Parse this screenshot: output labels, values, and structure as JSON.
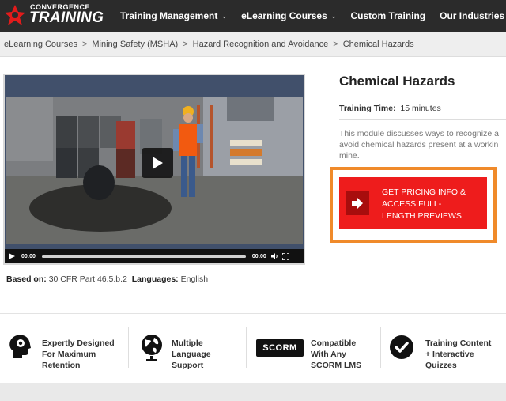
{
  "logo": {
    "small": "CONVERGENCE",
    "big": "TRAINING"
  },
  "nav": [
    {
      "label": "Training Management",
      "chevron": true
    },
    {
      "label": "eLearning Courses",
      "chevron": true
    },
    {
      "label": "Custom Training",
      "chevron": false
    },
    {
      "label": "Our Industries",
      "chevron": true
    }
  ],
  "breadcrumb": [
    "eLearning Courses",
    "Mining Safety (MSHA)",
    "Hazard Recognition and Avoidance",
    "Chemical Hazards"
  ],
  "breadcrumb_sep": ">",
  "video": {
    "current_time": "00:00",
    "duration": "00:00",
    "progress": 0
  },
  "meta": {
    "based_on_label": "Based on:",
    "based_on_value": "30 CFR Part 46.5.b.2",
    "languages_label": "Languages:",
    "languages_value": "English"
  },
  "course": {
    "title": "Chemical Hazards",
    "training_time_label": "Training Time:",
    "training_time_value": "15 minutes",
    "description_lines": [
      "This module discusses ways to recognize a",
      "avoid chemical hazards present at a workin",
      "mine."
    ]
  },
  "cta": {
    "lines": [
      "GET PRICING INFO &",
      "ACCESS FULL-",
      "LENGTH PREVIEWS"
    ]
  },
  "features": [
    {
      "icon": "head-gear-icon",
      "lines": [
        "Expertly Designed",
        "For Maximum",
        "Retention"
      ]
    },
    {
      "icon": "globe-icon",
      "lines": [
        "Multiple",
        "Language",
        "Support"
      ]
    },
    {
      "icon": "scorm-logo",
      "badge": "SCORM",
      "lines": [
        "Compatible",
        "With Any",
        "SCORM LMS"
      ]
    },
    {
      "icon": "checkmark-circle-icon",
      "lines": [
        "Training Content",
        "+ Interactive",
        "Quizzes"
      ]
    }
  ],
  "colors": {
    "nav_bg": "#2b2b2b",
    "cta_red": "#ee1c1c",
    "cta_frame": "#f08a2a",
    "crumb_bg": "#eeeeee"
  }
}
